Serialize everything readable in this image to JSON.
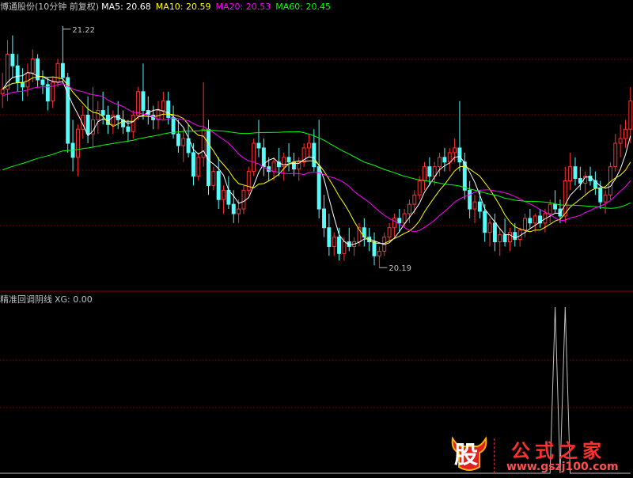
{
  "header": {
    "title": "博通股份(10分钟 前复权)",
    "ma5_label": "MA5: 20.68",
    "ma10_label": "MA10: 20.59",
    "ma20_label": "MA20: 20.53",
    "ma60_label": "MA60: 20.45"
  },
  "indicator": {
    "name": "精准回调阴线",
    "value_label": "XG: 0.00"
  },
  "watermark": {
    "badge_char": "股",
    "title": "公式之家",
    "url": "www.gszj100.com"
  },
  "colors": {
    "background": "#000000",
    "up": "#ff3232",
    "down": "#54fcfc",
    "ma5": "#ffffff",
    "ma10": "#ffff00",
    "ma20": "#ff00ff",
    "ma60": "#00ff00",
    "grid": "#8b0000",
    "text": "#c0c0c0"
  },
  "chart_data": [
    {
      "type": "candlestick",
      "title": "博通股份(10分钟 前复权)",
      "ylim": [
        20.15,
        21.27
      ],
      "annotations": [
        {
          "label": "21.22",
          "value": 21.22,
          "candle_index": 12
        },
        {
          "label": "20.19",
          "value": 20.19,
          "candle_index": 75
        }
      ],
      "series": [
        {
          "name": "MA5",
          "label": "MA5: 20.68"
        },
        {
          "name": "MA10",
          "label": "MA10: 20.59"
        },
        {
          "name": "MA20",
          "label": "MA20: 20.53"
        },
        {
          "name": "MA60",
          "label": "MA60: 20.45"
        }
      ],
      "ohlc": [
        [
          20.93,
          21.02,
          20.87,
          20.95
        ],
        [
          20.95,
          21.16,
          20.9,
          21.1
        ],
        [
          21.1,
          21.18,
          21.0,
          21.05
        ],
        [
          21.05,
          21.1,
          20.94,
          20.98
        ],
        [
          20.98,
          21.04,
          20.9,
          20.96
        ],
        [
          20.96,
          21.06,
          20.92,
          21.02
        ],
        [
          21.02,
          21.12,
          20.98,
          21.08
        ],
        [
          21.08,
          21.1,
          20.96,
          20.99
        ],
        [
          20.99,
          21.03,
          20.93,
          20.97
        ],
        [
          20.97,
          21.0,
          20.86,
          20.9
        ],
        [
          20.9,
          21.0,
          20.87,
          20.98
        ],
        [
          20.98,
          21.08,
          20.96,
          21.06
        ],
        [
          21.06,
          21.22,
          20.98,
          21.0
        ],
        [
          21.0,
          21.02,
          20.68,
          20.72
        ],
        [
          20.72,
          20.82,
          20.6,
          20.66
        ],
        [
          20.66,
          20.8,
          20.58,
          20.78
        ],
        [
          20.78,
          20.88,
          20.74,
          20.84
        ],
        [
          20.84,
          20.92,
          20.72,
          20.76
        ],
        [
          20.76,
          20.96,
          20.7,
          20.82
        ],
        [
          20.82,
          20.9,
          20.76,
          20.86
        ],
        [
          20.86,
          20.94,
          20.8,
          20.84
        ],
        [
          20.84,
          20.88,
          20.76,
          20.8
        ],
        [
          20.8,
          20.86,
          20.76,
          20.84
        ],
        [
          20.84,
          20.9,
          20.78,
          20.82
        ],
        [
          20.82,
          20.86,
          20.76,
          20.79
        ],
        [
          20.79,
          20.82,
          20.73,
          20.77
        ],
        [
          20.77,
          20.86,
          20.74,
          20.84
        ],
        [
          20.84,
          20.96,
          20.82,
          20.94
        ],
        [
          20.94,
          21.06,
          20.82,
          20.86
        ],
        [
          20.86,
          20.92,
          20.8,
          20.84
        ],
        [
          20.84,
          20.88,
          20.78,
          20.82
        ],
        [
          20.82,
          20.9,
          20.78,
          20.86
        ],
        [
          20.86,
          20.94,
          20.82,
          20.9
        ],
        [
          20.9,
          20.94,
          20.8,
          20.83
        ],
        [
          20.83,
          20.88,
          20.74,
          20.76
        ],
        [
          20.76,
          20.82,
          20.68,
          20.71
        ],
        [
          20.71,
          20.78,
          20.64,
          20.74
        ],
        [
          20.74,
          20.8,
          20.66,
          20.68
        ],
        [
          20.68,
          20.72,
          20.54,
          20.58
        ],
        [
          20.58,
          20.68,
          20.56,
          20.66
        ],
        [
          20.66,
          20.98,
          20.62,
          20.78
        ],
        [
          20.78,
          20.82,
          20.5,
          20.54
        ],
        [
          20.54,
          20.62,
          20.52,
          20.6
        ],
        [
          20.6,
          20.66,
          20.44,
          20.48
        ],
        [
          20.48,
          20.54,
          20.42,
          20.52
        ],
        [
          20.52,
          20.58,
          20.44,
          20.46
        ],
        [
          20.46,
          20.52,
          20.38,
          20.42
        ],
        [
          20.42,
          20.48,
          20.38,
          20.44
        ],
        [
          20.44,
          20.54,
          20.42,
          20.52
        ],
        [
          20.52,
          20.62,
          20.5,
          20.6
        ],
        [
          20.6,
          20.74,
          20.58,
          20.72
        ],
        [
          20.72,
          20.82,
          20.66,
          20.7
        ],
        [
          20.7,
          20.74,
          20.58,
          20.62
        ],
        [
          20.62,
          20.66,
          20.56,
          20.6
        ],
        [
          20.6,
          20.66,
          20.56,
          20.64
        ],
        [
          20.64,
          20.7,
          20.58,
          20.62
        ],
        [
          20.62,
          20.68,
          20.56,
          20.66
        ],
        [
          20.66,
          20.72,
          20.6,
          20.64
        ],
        [
          20.64,
          20.68,
          20.58,
          20.61
        ],
        [
          20.61,
          20.66,
          20.56,
          20.64
        ],
        [
          20.64,
          20.72,
          20.62,
          20.7
        ],
        [
          20.7,
          20.76,
          20.66,
          20.72
        ],
        [
          20.72,
          20.78,
          20.6,
          20.62
        ],
        [
          20.62,
          20.82,
          20.4,
          20.44
        ],
        [
          20.44,
          20.5,
          20.32,
          20.36
        ],
        [
          20.36,
          20.42,
          20.24,
          20.28
        ],
        [
          20.28,
          20.34,
          20.24,
          20.32
        ],
        [
          20.32,
          20.36,
          20.22,
          20.25
        ],
        [
          20.25,
          20.32,
          20.22,
          20.3
        ],
        [
          20.3,
          20.36,
          20.26,
          20.28
        ],
        [
          20.28,
          20.32,
          20.24,
          20.3
        ],
        [
          20.3,
          20.38,
          20.28,
          20.36
        ],
        [
          20.36,
          20.4,
          20.28,
          20.32
        ],
        [
          20.32,
          20.36,
          20.26,
          20.3
        ],
        [
          20.3,
          20.34,
          20.2,
          20.24
        ],
        [
          20.24,
          20.28,
          20.19,
          20.26
        ],
        [
          20.26,
          20.34,
          20.24,
          20.32
        ],
        [
          20.32,
          20.38,
          20.3,
          20.36
        ],
        [
          20.36,
          20.42,
          20.32,
          20.4
        ],
        [
          20.4,
          20.44,
          20.34,
          20.38
        ],
        [
          20.38,
          20.44,
          20.36,
          20.42
        ],
        [
          20.42,
          20.48,
          20.38,
          20.46
        ],
        [
          20.46,
          20.52,
          20.42,
          20.5
        ],
        [
          20.5,
          20.58,
          20.48,
          20.56
        ],
        [
          20.56,
          20.64,
          20.52,
          20.62
        ],
        [
          20.62,
          20.66,
          20.54,
          20.58
        ],
        [
          20.58,
          20.64,
          20.54,
          20.62
        ],
        [
          20.62,
          20.68,
          20.58,
          20.66
        ],
        [
          20.66,
          20.7,
          20.6,
          20.64
        ],
        [
          20.64,
          20.7,
          20.6,
          20.68
        ],
        [
          20.68,
          20.74,
          20.64,
          20.7
        ],
        [
          20.7,
          20.9,
          20.6,
          20.64
        ],
        [
          20.64,
          20.68,
          20.48,
          20.52
        ],
        [
          20.52,
          20.56,
          20.4,
          20.44
        ],
        [
          20.44,
          20.5,
          20.38,
          20.47
        ],
        [
          20.47,
          20.52,
          20.4,
          20.43
        ],
        [
          20.43,
          20.46,
          20.3,
          20.34
        ],
        [
          20.34,
          20.4,
          20.28,
          20.38
        ],
        [
          20.38,
          20.42,
          20.26,
          20.3
        ],
        [
          20.3,
          20.36,
          20.24,
          20.33
        ],
        [
          20.33,
          20.4,
          20.28,
          20.3
        ],
        [
          20.3,
          20.36,
          20.26,
          20.34
        ],
        [
          20.34,
          20.38,
          20.28,
          20.31
        ],
        [
          20.31,
          20.36,
          20.28,
          20.35
        ],
        [
          20.35,
          20.42,
          20.32,
          20.4
        ],
        [
          20.4,
          20.44,
          20.36,
          20.38
        ],
        [
          20.38,
          20.42,
          20.34,
          20.41
        ],
        [
          20.41,
          20.44,
          20.36,
          20.38
        ],
        [
          20.38,
          20.44,
          20.34,
          20.42
        ],
        [
          20.42,
          20.48,
          20.38,
          20.46
        ],
        [
          20.46,
          20.52,
          20.42,
          20.44
        ],
        [
          20.44,
          20.48,
          20.38,
          20.41
        ],
        [
          20.41,
          20.62,
          20.38,
          20.56
        ],
        [
          20.56,
          20.68,
          20.52,
          20.62
        ],
        [
          20.62,
          20.66,
          20.54,
          20.57
        ],
        [
          20.57,
          20.62,
          20.52,
          20.55
        ],
        [
          20.55,
          20.6,
          20.5,
          20.58
        ],
        [
          20.58,
          20.62,
          20.54,
          20.56
        ],
        [
          20.56,
          20.6,
          20.5,
          20.53
        ],
        [
          20.53,
          20.56,
          20.44,
          20.47
        ],
        [
          20.47,
          20.52,
          20.42,
          20.5
        ],
        [
          20.5,
          20.64,
          20.48,
          20.62
        ],
        [
          20.62,
          20.76,
          20.6,
          20.72
        ],
        [
          20.72,
          20.8,
          20.66,
          20.74
        ],
        [
          20.74,
          20.82,
          20.7,
          20.78
        ],
        [
          20.78,
          20.96,
          20.72,
          20.9
        ]
      ]
    },
    {
      "type": "line",
      "title": "精准回调阴线",
      "series": [
        {
          "name": "XG",
          "label": "XG: 0.00"
        }
      ],
      "ylim": [
        0,
        1
      ],
      "y": [
        0,
        0,
        0,
        0,
        0,
        0,
        0,
        0,
        0,
        0,
        0,
        0,
        0,
        0,
        0,
        0,
        0,
        0,
        0,
        0,
        0,
        0,
        0,
        0,
        0,
        0,
        0,
        0,
        0,
        0,
        0,
        0,
        0,
        0,
        0,
        0,
        0,
        0,
        0,
        0,
        0,
        0,
        0,
        0,
        0,
        0,
        0,
        0,
        0,
        0,
        0,
        0,
        0,
        0,
        0,
        0,
        0,
        0,
        0,
        0,
        0,
        0,
        0,
        0,
        0,
        0,
        0,
        0,
        0,
        0,
        0,
        0,
        0,
        0,
        0,
        0,
        0,
        0,
        0,
        0,
        0,
        0,
        0,
        0,
        0,
        0,
        0,
        0,
        0,
        0,
        0,
        0,
        0,
        0,
        0,
        0,
        0,
        0,
        0,
        0,
        0,
        0,
        0,
        0,
        0,
        0,
        0,
        0,
        0,
        0,
        1,
        0,
        1,
        0,
        0,
        0,
        0,
        0,
        0,
        0,
        0,
        0,
        0,
        0,
        0,
        0
      ]
    }
  ]
}
